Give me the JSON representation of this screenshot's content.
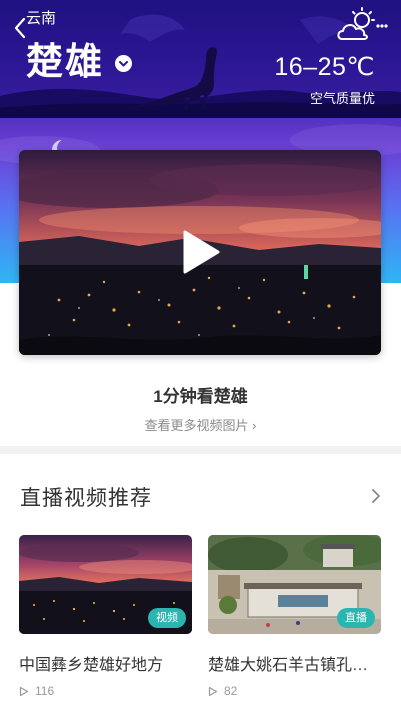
{
  "header": {
    "province": "云南",
    "city": "楚雄",
    "temperature": "16–25℃",
    "air_quality": "空气质量优",
    "weather_icon": "partly-cloudy-day-icon"
  },
  "main_video": {
    "title": "1分钟看楚雄",
    "more_link": "查看更多视频图片 ›"
  },
  "recommend": {
    "title": "直播视频推荐",
    "items": [
      {
        "title": "中国彝乡楚雄好地方",
        "tag": "视频",
        "views": "116"
      },
      {
        "title": "楚雄大姚石羊古镇孔…",
        "tag": "直播",
        "views": "82"
      }
    ]
  },
  "colors": {
    "hero_top": "#2d1796",
    "hero_bottom": "#2fb6f5",
    "tag": "#2bb5b1"
  }
}
